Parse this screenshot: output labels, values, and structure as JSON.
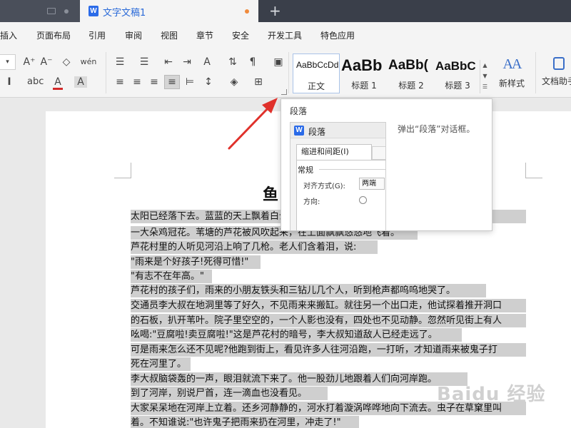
{
  "titlebar": {
    "active_tab": "文字文稿1",
    "new_tab": "+"
  },
  "menu": [
    {
      "label": "插入"
    },
    {
      "label": "页面布局"
    },
    {
      "label": "引用"
    },
    {
      "label": "审阅"
    },
    {
      "label": "视图"
    },
    {
      "label": "章节"
    },
    {
      "label": "安全"
    },
    {
      "label": "开发工具"
    },
    {
      "label": "特色应用"
    }
  ],
  "ribbon": {
    "font_grow": "A⁺",
    "font_shrink": "A⁻",
    "phonetic": "wén",
    "styles": [
      {
        "sample": "AaBbCcDd",
        "label": "正文"
      },
      {
        "sample": "AaBb",
        "label": "标题 1"
      },
      {
        "sample": "AaBb(",
        "label": "标题 2"
      },
      {
        "sample": "AaBbC",
        "label": "标题 3"
      }
    ],
    "new_style": "新样式",
    "assistant": "文档助手",
    "new_style_icon": "AA"
  },
  "popup": {
    "title": "段落",
    "description": "弹出“段落”对话框。",
    "preview": {
      "dialog_title": "段落",
      "tab": "缩进和间距(I)",
      "section": "常规",
      "align_label": "对齐方式(G):",
      "align_value": "两端",
      "direction_label": "方向:"
    }
  },
  "document": {
    "title": "鱼",
    "lines": [
      "太阳已经落下去。蓝蓝的天上飘着白云，那白云镶上了金边，一朵一朵地了一大朵",
      "一大朵鸡冠花。苇塘的芦花被风吹起来，在上面飘飘悠悠地飞着。",
      "芦花村里的人听见河沿上响了几枪。老人们含着泪，说:",
      "\"雨来是个好孩子!死得可惜!\"",
      "\"有志不在年高。\"",
      "芦花村的孩子们，雨来的小朋友铁头和三钻儿几个人，听到枪声都呜呜地哭了。",
      "交通员李大叔在地洞里等了好久，不见雨来来搬缸。就往另一个出口走，他试探着推开洞口",
      "的石板，扒开苇叶。院子里空空的，一个人影也没有，四处也不见动静。忽然听见街上有人",
      "吆喝:\"豆腐啦!卖豆腐啦!\"这是芦花村的暗号，李大叔知道敌人已经走远了。",
      "可是雨来怎么还不见呢?他跑到街上，看见许多人往河沿跑，一打听，才知道雨来被鬼子打",
      "死在河里了。",
      "李大叔脑袋轰的一声，眼泪就流下来了。他一股劲儿地跟着人们向河岸跑。",
      "到了河岸，别说尸首，连一滴血也没看见。",
      "大家呆呆地在河岸上立着。还乡河静静的，河水打着漩涡哗哗地向下流去。虫子在草窠里叫",
      "着。不知谁说:\"也许鬼子把雨来扔在河里，冲走了!\""
    ]
  },
  "watermark": "Baidu 经验",
  "colors": {
    "titlebar": "#3a3f4a",
    "accent": "#2a6ad8",
    "arrow": "#e0312b",
    "highlight": "#cfcfcf"
  }
}
